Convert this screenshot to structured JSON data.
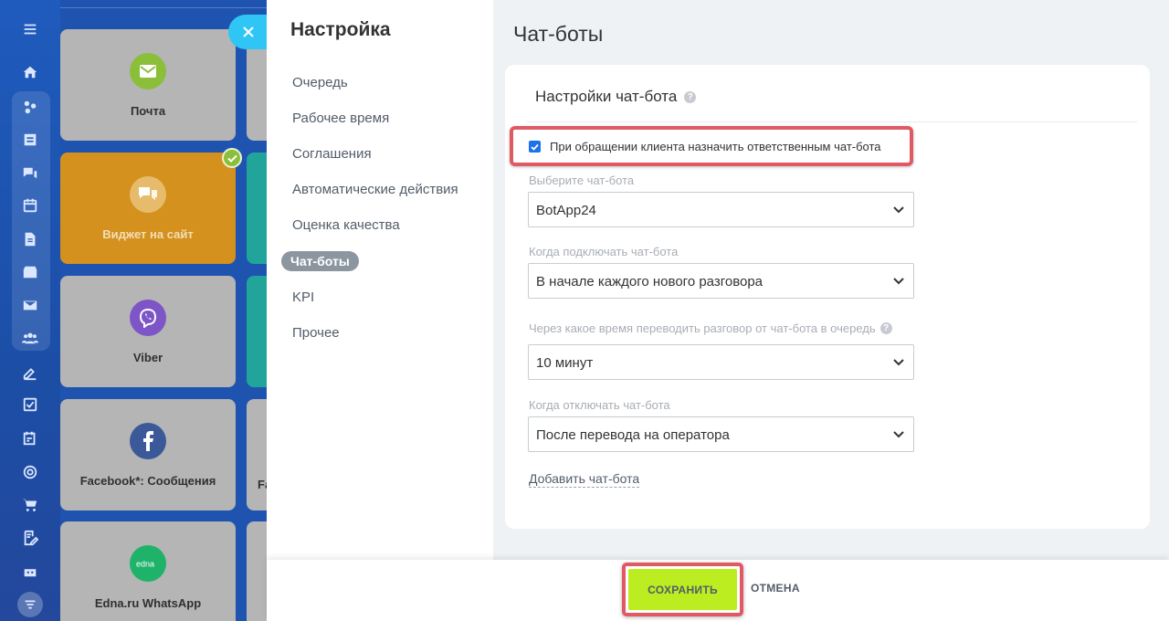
{
  "colors": {
    "sidebar_bg": "#1f5bbd",
    "accent_blue": "#1a73e8",
    "save_green": "#bbed21",
    "highlight_red": "#e05a63",
    "widget_orange": "#d4911e"
  },
  "sidebar": {
    "icons": [
      "menu-icon",
      "home-icon",
      "crm-icon",
      "feed-icon",
      "chat-icon",
      "calendar-icon",
      "document-icon",
      "inbox-icon",
      "mail-icon",
      "users-icon",
      "sign-icon",
      "tasks-icon",
      "schedule-icon",
      "target-icon",
      "cart-icon",
      "edit-icon",
      "robot-icon",
      "filter-icon"
    ]
  },
  "tiles": [
    {
      "label": "Почта",
      "icon": "mail-icon",
      "color": "#8bbf3a"
    },
    {
      "label": "Виджет на сайт",
      "icon": "chat-bubbles-icon",
      "color": "#d4911e"
    },
    {
      "label": "Viber",
      "icon": "viber-icon",
      "color": "#7d55c7"
    },
    {
      "label": "Facebook*: Сообщения",
      "icon": "facebook-icon",
      "color": "#3b5998"
    },
    {
      "label": "Edna.ru WhatsApp",
      "icon": "edna-icon",
      "color": "#1fb36a"
    }
  ],
  "tiles_partial_labels": [
    "Fa"
  ],
  "settings": {
    "title": "Настройка",
    "menu": [
      "Очередь",
      "Рабочее время",
      "Соглашения",
      "Автоматические действия",
      "Оценка качества",
      "Чат-боты",
      "KPI",
      "Прочее"
    ],
    "active_index": 5
  },
  "content": {
    "title": "Чат-боты",
    "card_title": "Настройки чат-бота",
    "checkbox_label": "При обращении клиента назначить ответственным чат-бота",
    "checkbox_checked": true,
    "fields": [
      {
        "label": "Выберите чат-бота",
        "value": "BotApp24",
        "help": false
      },
      {
        "label": "Когда подключать чат-бота",
        "value": "В начале каждого нового разговора",
        "help": false
      },
      {
        "label": "Через какое время переводить разговор от чат-бота в очередь",
        "value": "10 минут",
        "help": true
      },
      {
        "label": "Когда отключать чат-бота",
        "value": "После перевода на оператора",
        "help": false
      }
    ],
    "add_link": "Добавить чат-бота"
  },
  "footer": {
    "save_label": "СОХРАНИТЬ",
    "cancel_label": "ОТМЕНА"
  }
}
